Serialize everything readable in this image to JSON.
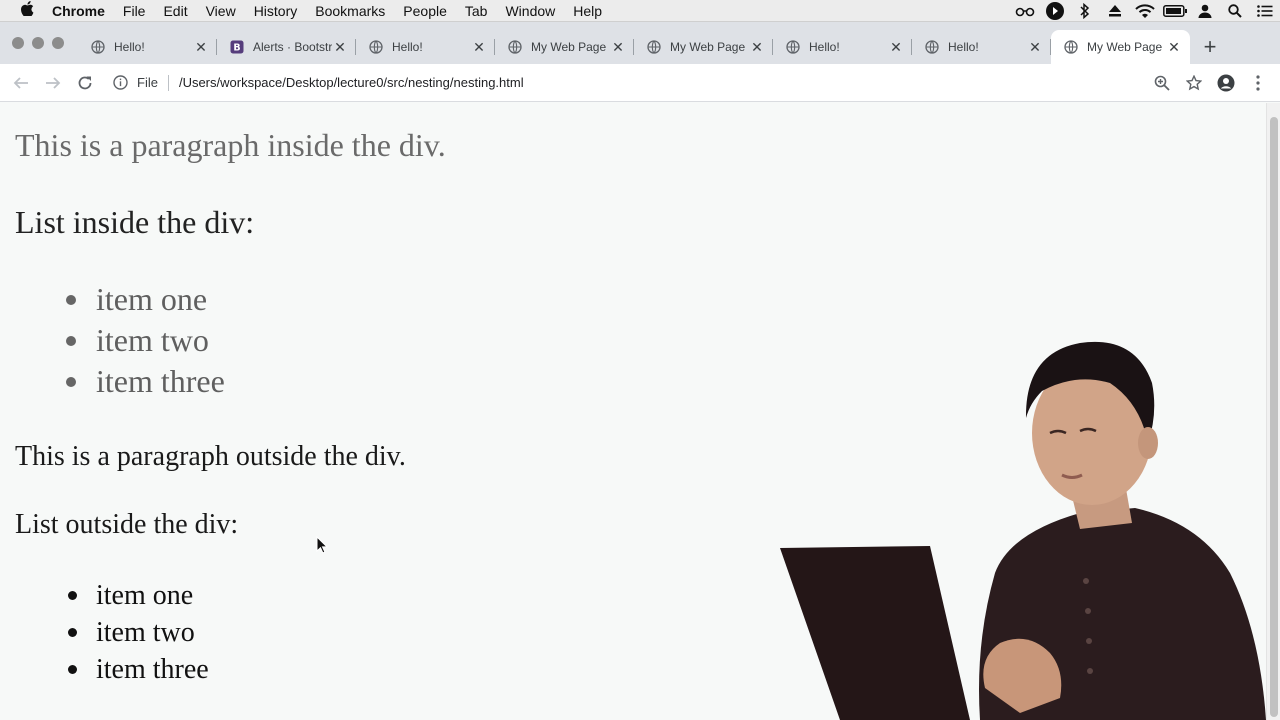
{
  "menubar": {
    "app_name": "Chrome",
    "items": [
      "File",
      "Edit",
      "View",
      "History",
      "Bookmarks",
      "People",
      "Tab",
      "Window",
      "Help"
    ]
  },
  "tabs": [
    {
      "title": "Hello!",
      "favicon": "globe-icon",
      "active": false
    },
    {
      "title": "Alerts · Bootstrap",
      "favicon": "bootstrap-icon",
      "active": false
    },
    {
      "title": "Hello!",
      "favicon": "globe-icon",
      "active": false
    },
    {
      "title": "My Web Page",
      "favicon": "globe-icon",
      "active": false
    },
    {
      "title": "My Web Page",
      "favicon": "globe-icon",
      "active": false
    },
    {
      "title": "Hello!",
      "favicon": "globe-icon",
      "active": false
    },
    {
      "title": "Hello!",
      "favicon": "globe-icon",
      "active": false
    },
    {
      "title": "My Web Page",
      "favicon": "globe-icon",
      "active": true
    }
  ],
  "toolbar": {
    "scheme_label": "File",
    "url": "/Users/workspace/Desktop/lecture0/src/nesting/nesting.html"
  },
  "page": {
    "paragraph_inside": "This is a paragraph inside the div.",
    "list_inside_heading": "List inside the div:",
    "list_inside": [
      "item one",
      "item two",
      "item three"
    ],
    "paragraph_outside": "This is a paragraph outside the div.",
    "list_outside_heading": "List outside the div:",
    "list_outside": [
      "item one",
      "item two",
      "item three"
    ]
  },
  "colors": {
    "tabstrip_bg": "#dee1e6",
    "inside_div_text": "#666666",
    "outside_div_text": "#1a1a1a"
  }
}
